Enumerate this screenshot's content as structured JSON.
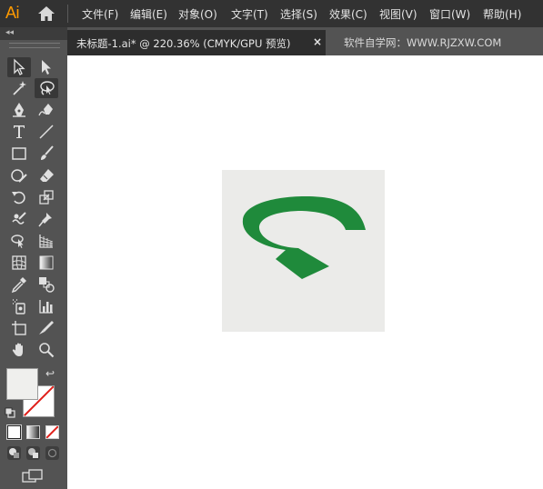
{
  "app": {
    "logo": "Ai"
  },
  "menu": [
    "文件(F)",
    "编辑(E)",
    "对象(O)",
    "文字(T)",
    "选择(S)",
    "效果(C)",
    "视图(V)",
    "窗口(W)",
    "帮助(H)"
  ],
  "tabs": {
    "active": "未标题-1.ai* @ 220.36% (CMYK/GPU 预览)",
    "close": "×",
    "inactive": "软件自学网：WWW.RJZXW.COM"
  },
  "colors": {
    "menubar": "#323232",
    "panel": "#535353",
    "artboard_bg": "#ffffff",
    "art_square": "#ebebe9",
    "arrow_green": "#1f8a3b",
    "stroke_none_red": "#e0201b"
  },
  "tools": [
    "selection-tool",
    "direct-selection-tool",
    "magic-wand-tool",
    "lasso-tool",
    "pen-tool",
    "curvature-tool",
    "type-tool",
    "line-segment-tool",
    "rectangle-tool",
    "paintbrush-tool",
    "shaper-tool",
    "eraser-tool",
    "rotate-tool",
    "scale-tool",
    "warp-tool",
    "puppet-warp-tool",
    "shape-builder-tool",
    "perspective-grid-tool",
    "mesh-tool",
    "gradient-tool",
    "eyedropper-tool",
    "blend-tool",
    "symbol-sprayer-tool",
    "column-graph-tool",
    "artboard-tool",
    "slice-tool",
    "hand-tool",
    "zoom-tool"
  ]
}
